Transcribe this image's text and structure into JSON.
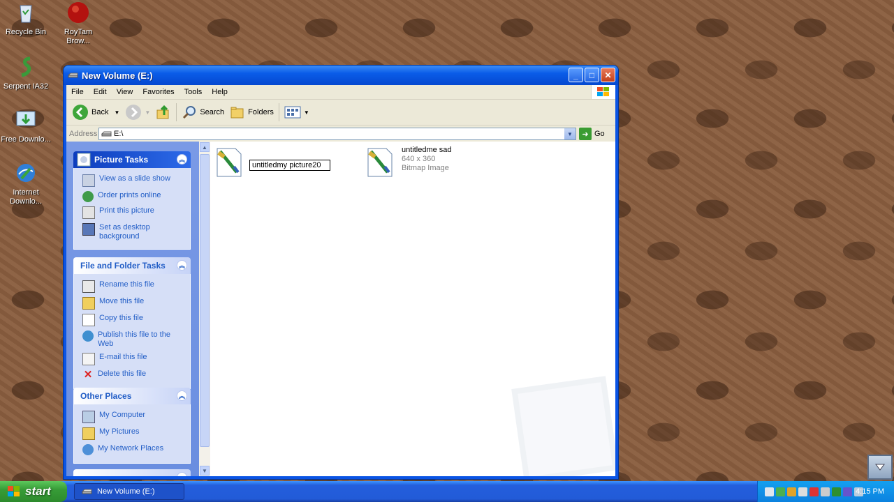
{
  "desktop": {
    "icons": [
      {
        "label": "Recycle Bin",
        "icon": "recycle-bin-icon"
      },
      {
        "label": "RoyTam Brow...",
        "icon": "browser-icon"
      },
      {
        "label": "Serpent IA32",
        "icon": "serpent-icon"
      },
      {
        "label": "Free Downlo...",
        "icon": "download-icon"
      },
      {
        "label": "Internet Downlo...",
        "icon": "internet-download-icon"
      }
    ]
  },
  "window": {
    "title": "New Volume (E:)",
    "menu": [
      "File",
      "Edit",
      "View",
      "Favorites",
      "Tools",
      "Help"
    ],
    "toolbar": {
      "back": "Back",
      "search": "Search",
      "folders": "Folders"
    },
    "address": {
      "label": "Address",
      "value": "E:\\",
      "go": "Go"
    }
  },
  "taskpane": {
    "picture_tasks": {
      "title": "Picture Tasks",
      "items": [
        "View as a slide show",
        "Order prints online",
        "Print this picture",
        "Set as desktop background"
      ]
    },
    "file_tasks": {
      "title": "File and Folder Tasks",
      "items": [
        "Rename this file",
        "Move this file",
        "Copy this file",
        "Publish this file to the Web",
        "E-mail this file",
        "Delete this file"
      ]
    },
    "other_places": {
      "title": "Other Places",
      "items": [
        "My Computer",
        "My Pictures",
        "My Network Places"
      ]
    }
  },
  "files": [
    {
      "name": "untitledmy picture20",
      "editing": true
    },
    {
      "name": "untitledme sad",
      "dimensions": "640 x 360",
      "type": "Bitmap Image"
    }
  ],
  "taskbar": {
    "start": "start",
    "active_task": "New Volume (E:)",
    "clock": "4:15 PM"
  }
}
